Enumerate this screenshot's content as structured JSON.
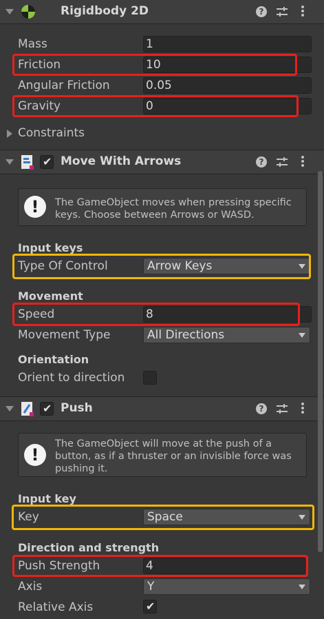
{
  "colors": {
    "highlight_red": "#e8201a",
    "highlight_yellow": "#f2b705",
    "panel_bg": "#383838",
    "header_bg": "#3e3e3e"
  },
  "rigidbody": {
    "title": "Rigidbody 2D",
    "icon": "rigidbody-2d-icon",
    "fields": {
      "mass_label": "Mass",
      "mass_value": "1",
      "friction_label": "Friction",
      "friction_value": "10",
      "angular_label": "Angular Friction",
      "angular_value": "0.05",
      "gravity_label": "Gravity",
      "gravity_value": "0"
    },
    "constraints_label": "Constraints"
  },
  "move_with_arrows": {
    "title": "Move With Arrows",
    "enabled": true,
    "help": [
      "The GameObject moves when pressing specific",
      "keys. Choose between Arrows or WASD."
    ],
    "input_section": "Input keys",
    "type_label": "Type Of Control",
    "type_value": "Arrow Keys",
    "movement_section": "Movement",
    "speed_label": "Speed",
    "speed_value": "8",
    "movement_type_label": "Movement Type",
    "movement_type_value": "All Directions",
    "orientation_section": "Orientation",
    "orient_label": "Orient to direction",
    "orient_checked": false
  },
  "push": {
    "title": "Push",
    "enabled": true,
    "help": [
      "The GameObject will move at the push of a",
      "button, as if a thruster or an invisible force was",
      "pushing it."
    ],
    "input_section": "Input key",
    "key_label": "Key",
    "key_value": "Space",
    "direction_section": "Direction and strength",
    "strength_label": "Push Strength",
    "strength_value": "4",
    "axis_label": "Axis",
    "axis_value": "Y",
    "relative_label": "Relative Axis",
    "relative_checked": true
  }
}
